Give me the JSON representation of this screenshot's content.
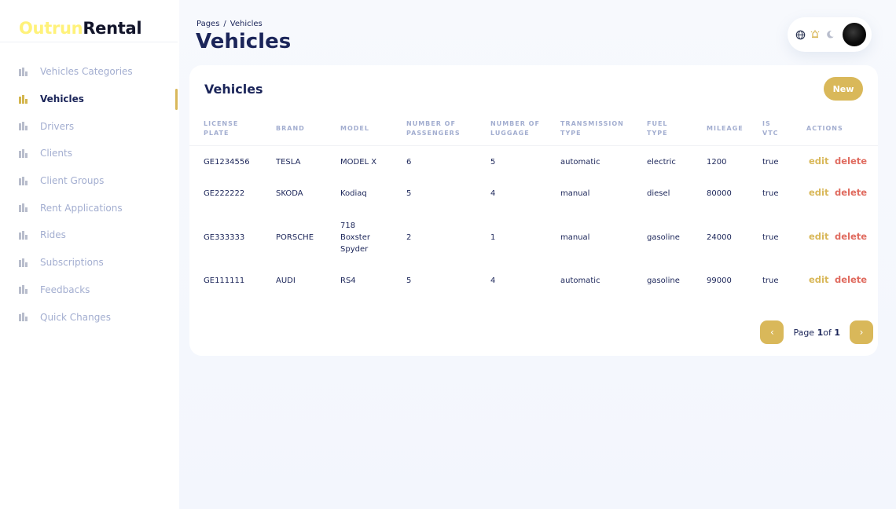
{
  "app": {
    "logo_part1": "Outrun",
    "logo_part2": "Rental"
  },
  "sidebar": {
    "items": [
      {
        "label": "Vehicles Categories",
        "active": false
      },
      {
        "label": "Vehicles",
        "active": true
      },
      {
        "label": "Drivers",
        "active": false
      },
      {
        "label": "Clients",
        "active": false
      },
      {
        "label": "Client Groups",
        "active": false
      },
      {
        "label": "Rent Applications",
        "active": false
      },
      {
        "label": "Rides",
        "active": false
      },
      {
        "label": "Subscriptions",
        "active": false
      },
      {
        "label": "Feedbacks",
        "active": false
      },
      {
        "label": "Quick Changes",
        "active": false
      }
    ]
  },
  "header": {
    "breadcrumb": [
      "Pages",
      "Vehicles"
    ],
    "breadcrumb_sep": "/",
    "title": "Vehicles"
  },
  "topbar": {
    "icons": [
      "globe-icon",
      "alarm-icon",
      "moon-icon"
    ]
  },
  "card": {
    "title": "Vehicles",
    "new_label": "New",
    "columns": [
      {
        "line1": "License",
        "line2": "Plate"
      },
      {
        "line1": "Brand",
        "line2": ""
      },
      {
        "line1": "Model",
        "line2": ""
      },
      {
        "line1": "Number of",
        "line2": "Passengers"
      },
      {
        "line1": "Number of",
        "line2": "Luggage"
      },
      {
        "line1": "Transmission",
        "line2": "Type"
      },
      {
        "line1": "Fuel",
        "line2": "Type"
      },
      {
        "line1": "Mileage",
        "line2": ""
      },
      {
        "line1": "Is",
        "line2": "VTC"
      },
      {
        "line1": "Actions",
        "line2": ""
      }
    ],
    "rows": [
      {
        "plate": "GE1234556",
        "brand": "TESLA",
        "model": [
          "MODEL X"
        ],
        "passengers": "6",
        "luggage": "5",
        "transmission": "automatic",
        "fuel": "electric",
        "mileage": "1200",
        "vtc": "true",
        "edit": "edit",
        "delete": "delete"
      },
      {
        "plate": "GE222222",
        "brand": "SKODA",
        "model": [
          "Kodiaq"
        ],
        "passengers": "5",
        "luggage": "4",
        "transmission": "manual",
        "fuel": "diesel",
        "mileage": "80000",
        "vtc": "true",
        "edit": "edit",
        "delete": "delete"
      },
      {
        "plate": "GE333333",
        "brand": "PORSCHE",
        "model": [
          "718",
          "Boxster",
          "Spyder"
        ],
        "passengers": "2",
        "luggage": "1",
        "transmission": "manual",
        "fuel": "gasoline",
        "mileage": "24000",
        "vtc": "true",
        "edit": "edit",
        "delete": "delete"
      },
      {
        "plate": "GE111111",
        "brand": "AUDI",
        "model": [
          "RS4"
        ],
        "passengers": "5",
        "luggage": "4",
        "transmission": "automatic",
        "fuel": "gasoline",
        "mileage": "99000",
        "vtc": "true",
        "edit": "edit",
        "delete": "delete"
      }
    ],
    "pagination": {
      "prev": "‹",
      "next": "›",
      "page_word": "Page",
      "current": "1",
      "of_word": "of",
      "total": "1"
    }
  },
  "colors": {
    "accent": "#d9b85a",
    "logo_yellow": "#fff27a",
    "danger": "#e06b5f",
    "text": "#1b2559",
    "muted": "#a3aed0"
  }
}
